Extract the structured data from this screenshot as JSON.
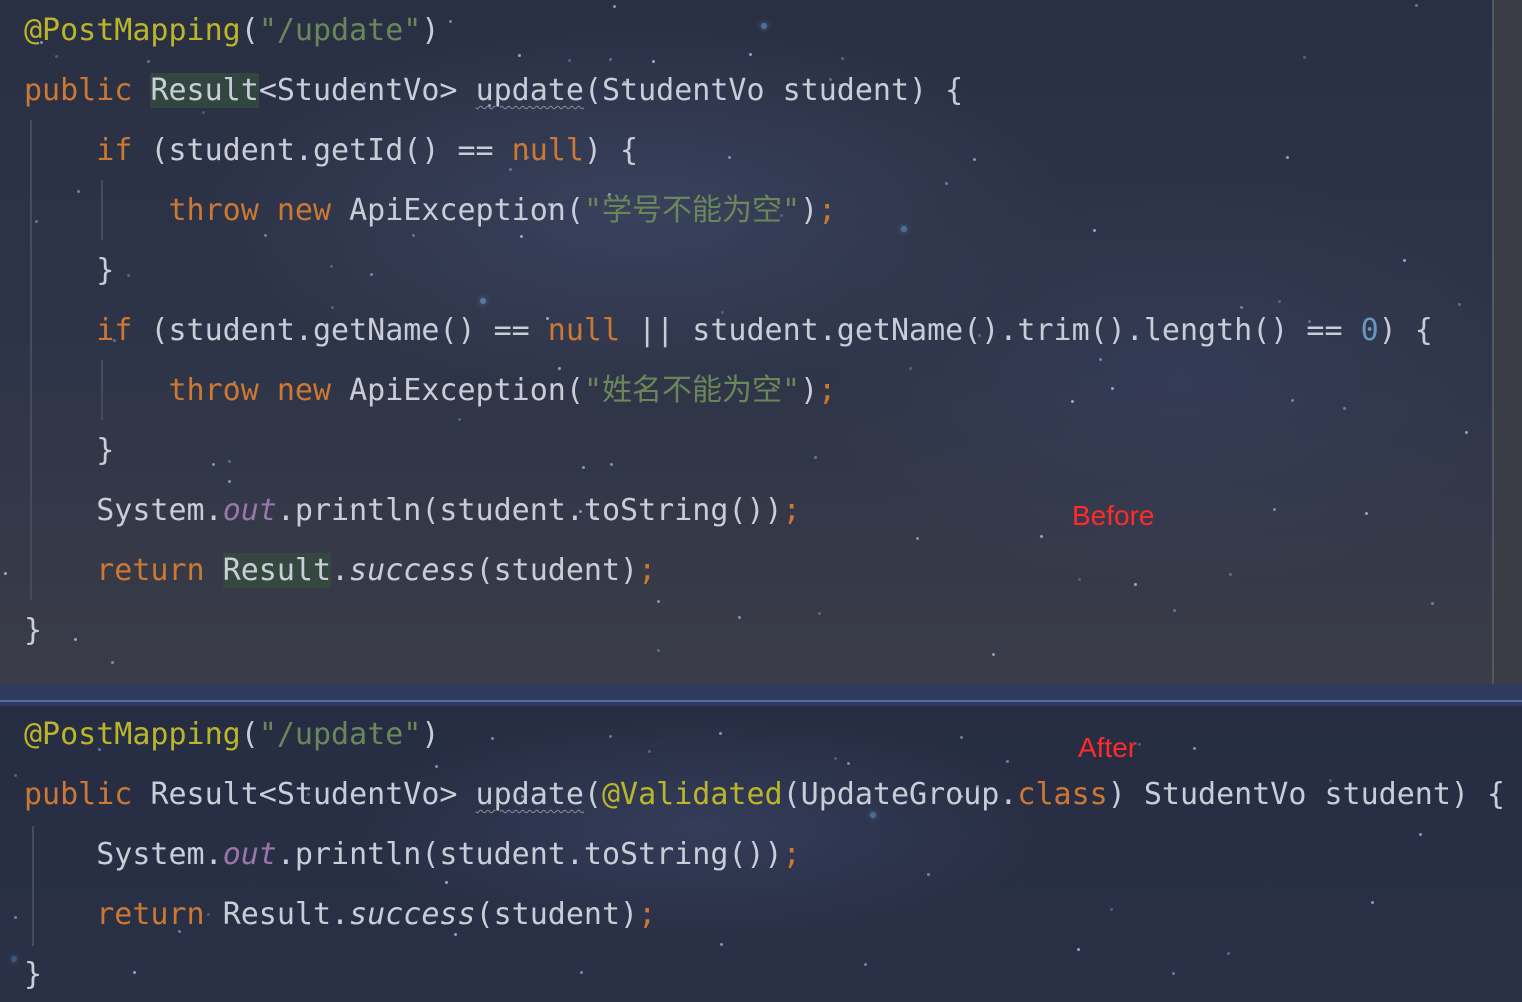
{
  "before": {
    "label": "Before",
    "lines": [
      {
        "segments": [
          [
            "ann",
            "@PostMapping"
          ],
          [
            "cls",
            "("
          ],
          [
            "str",
            "\"/update\""
          ],
          [
            "cls",
            ")"
          ]
        ]
      },
      {
        "segments": [
          [
            "kw",
            "public "
          ],
          [
            "hl",
            "Result"
          ],
          [
            "cls",
            "<StudentVo> "
          ],
          [
            "wavy",
            "update"
          ],
          [
            "cls",
            "(StudentVo student) {"
          ]
        ]
      },
      {
        "segments": [
          [
            "cls",
            "    "
          ],
          [
            "kw",
            "if "
          ],
          [
            "cls",
            "(student.getId() == "
          ],
          [
            "kw",
            "null"
          ],
          [
            "cls",
            ") {"
          ]
        ]
      },
      {
        "segments": [
          [
            "cls",
            "        "
          ],
          [
            "kw",
            "throw new "
          ],
          [
            "cls",
            "ApiException("
          ],
          [
            "str",
            "\"学号不能为空\""
          ],
          [
            "cls",
            ")"
          ],
          [
            "semi",
            ";"
          ]
        ]
      },
      {
        "segments": [
          [
            "cls",
            "    }"
          ]
        ]
      },
      {
        "segments": [
          [
            "cls",
            "    "
          ],
          [
            "kw",
            "if "
          ],
          [
            "cls",
            "(student.getName() == "
          ],
          [
            "kw",
            "null"
          ],
          [
            "cls",
            " || student.getName().trim().length() == "
          ],
          [
            "num",
            "0"
          ],
          [
            "cls",
            ") {"
          ]
        ]
      },
      {
        "segments": [
          [
            "cls",
            "        "
          ],
          [
            "kw",
            "throw new "
          ],
          [
            "cls",
            "ApiException("
          ],
          [
            "str",
            "\"姓名不能为空\""
          ],
          [
            "cls",
            ")"
          ],
          [
            "semi",
            ";"
          ]
        ]
      },
      {
        "segments": [
          [
            "cls",
            "    }"
          ]
        ]
      },
      {
        "segments": [
          [
            "cls",
            "    System."
          ],
          [
            "field",
            "out"
          ],
          [
            "cls",
            ".println(student.toString())"
          ],
          [
            "semi",
            ";"
          ]
        ]
      },
      {
        "segments": [
          [
            "cls",
            "    "
          ],
          [
            "kw",
            "return "
          ],
          [
            "hl",
            "Result"
          ],
          [
            "cls",
            "."
          ],
          [
            "static",
            "success"
          ],
          [
            "cls",
            "(student)"
          ],
          [
            "semi",
            ";"
          ]
        ]
      },
      {
        "segments": [
          [
            "cls",
            "}"
          ]
        ]
      }
    ]
  },
  "after": {
    "label": "After",
    "lines": [
      {
        "segments": [
          [
            "ann",
            "@PostMapping"
          ],
          [
            "cls",
            "("
          ],
          [
            "str",
            "\"/update\""
          ],
          [
            "cls",
            ")"
          ]
        ]
      },
      {
        "segments": [
          [
            "kw",
            "public "
          ],
          [
            "cls",
            "Result<StudentVo> "
          ],
          [
            "wavy",
            "update"
          ],
          [
            "cls",
            "("
          ],
          [
            "ann",
            "@Validated"
          ],
          [
            "cls",
            "(UpdateGroup."
          ],
          [
            "kw",
            "class"
          ],
          [
            "cls",
            ") StudentVo student) {"
          ]
        ]
      },
      {
        "segments": [
          [
            "cls",
            "    System."
          ],
          [
            "field",
            "out"
          ],
          [
            "cls",
            ".println(student.toString())"
          ],
          [
            "semi",
            ";"
          ]
        ]
      },
      {
        "segments": [
          [
            "cls",
            "    "
          ],
          [
            "kw",
            "return "
          ],
          [
            "cls",
            "Result."
          ],
          [
            "static",
            "success"
          ],
          [
            "cls",
            "(student)"
          ],
          [
            "semi",
            ";"
          ]
        ]
      },
      {
        "segments": [
          [
            "cls",
            "}"
          ]
        ]
      }
    ]
  },
  "colors": {
    "annotation": "#bbb529",
    "keyword": "#cc7832",
    "string": "#6a8759",
    "number": "#6897bb",
    "field": "#9876aa",
    "label": "#ff2b2b"
  }
}
